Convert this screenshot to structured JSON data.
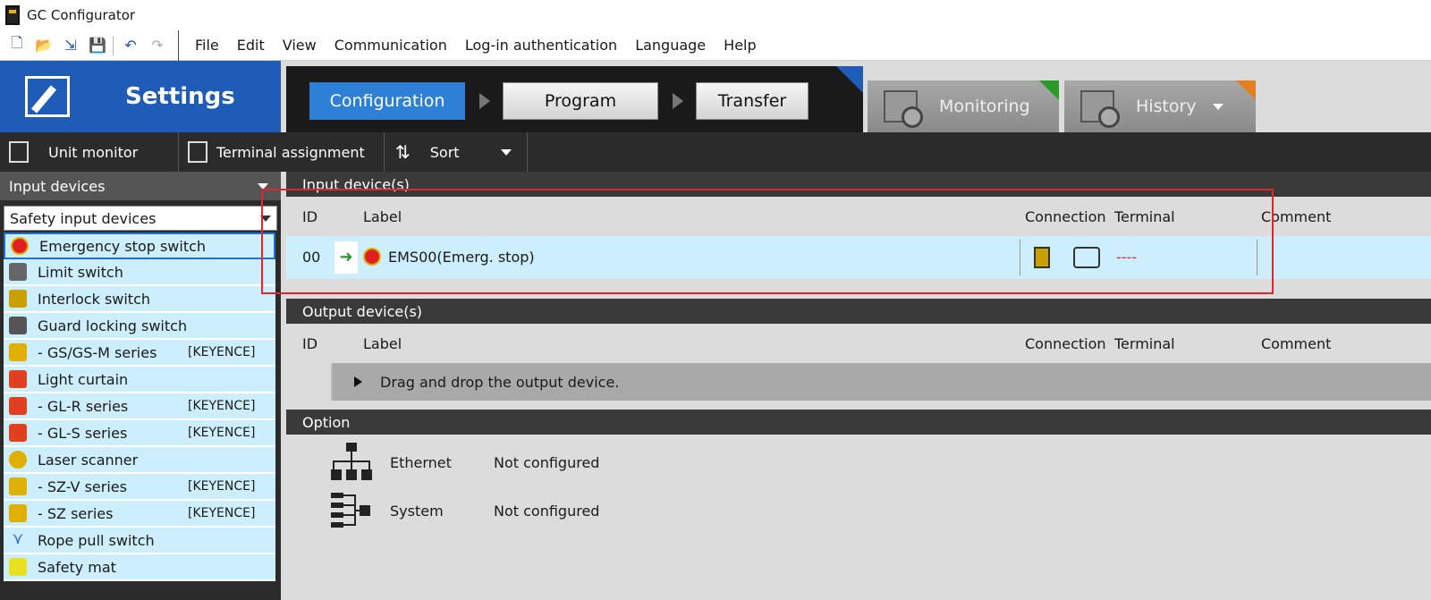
{
  "window": {
    "title": "GC Configurator"
  },
  "menu": [
    "File",
    "Edit",
    "View",
    "Communication",
    "Log-in authentication",
    "Language",
    "Help"
  ],
  "toolbar_icons": [
    "new-file-icon",
    "open-folder-icon",
    "import-icon",
    "save-icon",
    "undo-icon",
    "redo-icon"
  ],
  "settings": {
    "label": "Settings"
  },
  "workflow": {
    "configuration": "Configuration",
    "program": "Program",
    "transfer": "Transfer"
  },
  "tabs": {
    "monitoring": "Monitoring",
    "history": "History"
  },
  "toolbar2": {
    "unit_monitor": "Unit monitor",
    "terminal_assignment": "Terminal assignment",
    "sort": "Sort"
  },
  "left": {
    "header": "Input devices",
    "select_value": "Safety input devices",
    "items": [
      {
        "label": "Emergency stop switch",
        "brand": ""
      },
      {
        "label": "Limit switch",
        "brand": ""
      },
      {
        "label": "Interlock switch",
        "brand": ""
      },
      {
        "label": "Guard locking switch",
        "brand": ""
      },
      {
        "label": "- GS/GS-M series",
        "brand": "[KEYENCE]"
      },
      {
        "label": "Light curtain",
        "brand": ""
      },
      {
        "label": "- GL-R series",
        "brand": "[KEYENCE]"
      },
      {
        "label": "- GL-S series",
        "brand": "[KEYENCE]"
      },
      {
        "label": "Laser scanner",
        "brand": ""
      },
      {
        "label": "- SZ-V series",
        "brand": "[KEYENCE]"
      },
      {
        "label": "- SZ series",
        "brand": "[KEYENCE]"
      },
      {
        "label": "Rope pull switch",
        "brand": ""
      },
      {
        "label": "Safety mat",
        "brand": ""
      }
    ]
  },
  "input_section": {
    "title": "Input device(s)",
    "columns": {
      "id": "ID",
      "label": "Label",
      "connection": "Connection",
      "terminal": "Terminal",
      "comment": "Comment"
    },
    "row": {
      "id": "00",
      "label": "EMS00(Emerg. stop)",
      "terminal": "----"
    }
  },
  "output_section": {
    "title": "Output device(s)",
    "columns": {
      "id": "ID",
      "label": "Label",
      "connection": "Connection",
      "terminal": "Terminal",
      "comment": "Comment"
    },
    "drop_hint": "Drag and drop the output device."
  },
  "option_section": {
    "title": "Option",
    "rows": [
      {
        "name": "Ethernet",
        "status": "Not configured"
      },
      {
        "name": "System",
        "status": "Not configured"
      }
    ]
  },
  "colors": {
    "accent": "#1f5cb8",
    "active_step": "#2e7fd6",
    "list_bg": "#cdeefc",
    "highlight": "#e0262a",
    "terminal_text": "#e0262a"
  }
}
